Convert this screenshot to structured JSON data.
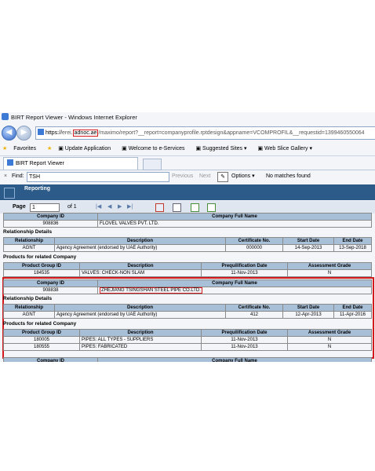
{
  "window": {
    "title": "BIRT Report Viewer - Windows Internet Explorer"
  },
  "address": {
    "prefix": "https://",
    "grey1": "erei.",
    "domain": "adnoc.ae",
    "rest": "/maximo/report?__report=companyprofile.rptdesign&appname=VCOMPROFIL&__requestid=1399460550064"
  },
  "favorites": {
    "label": "Favorites",
    "items": [
      "Update Application",
      "Welcome to e-Services",
      "Suggested Sites ▾",
      "Web Slice Gallery ▾"
    ]
  },
  "tab": {
    "label": "BIRT Report Viewer"
  },
  "find": {
    "close": "×",
    "label": "Find:",
    "value": "TSH",
    "previous": "Previous",
    "next": "Next",
    "options": "Options ▾",
    "status": "No matches found"
  },
  "report": {
    "header": "Reporting",
    "page_label": "Page",
    "page_value": "1",
    "of_text": "of 1"
  },
  "labels": {
    "company_id": "Company ID",
    "company_full_name": "Company Full Name",
    "relationship_details": "Relationship Details",
    "relationship": "Relationship",
    "description": "Description",
    "certificate_no": "Certificate No.",
    "start_date": "Start Date",
    "end_date": "End Date",
    "products_related": "Products for related Company",
    "product_group_id": "Product Group ID",
    "prequalification_date": "Prequilification Date",
    "assessment_grade": "Assessment Grade"
  },
  "company1": {
    "id": "908836",
    "name": "FLOVEL VALVES PVT. LTD.",
    "rel": {
      "relationship": "AGNT",
      "description": "Agency Agreement (endorsed by UAE Authority)",
      "certificate": "000000",
      "start": "14-Sep-2013",
      "end": "13-Sep-2018"
    },
    "products": [
      {
        "id": "184535",
        "description": "VALVES: CHECK-NON SLAM",
        "date": "11-Nov-2013",
        "grade": "N"
      }
    ]
  },
  "company2": {
    "id": "908838",
    "name": "ZHEJIANG TSINGSHAN STEEL PIPE CO.LTD.",
    "rel": {
      "relationship": "AGNT",
      "description": "Agency Agreement (endorsed by UAE Authority)",
      "certificate": "412",
      "start": "12-Apr-2013",
      "end": "11-Apr-2016"
    },
    "products": [
      {
        "id": "180005",
        "description": "PIPES: ALL TYPES - SUPPLIERS",
        "date": "11-Nov-2013",
        "grade": "N"
      },
      {
        "id": "180555",
        "description": "PIPES: FABRICATED",
        "date": "11-Nov-2013",
        "grade": "N"
      }
    ]
  },
  "colors": {
    "highlight": "#d4191c",
    "header_bar": "#2d5b89",
    "table_header": "#a8bfd8"
  }
}
